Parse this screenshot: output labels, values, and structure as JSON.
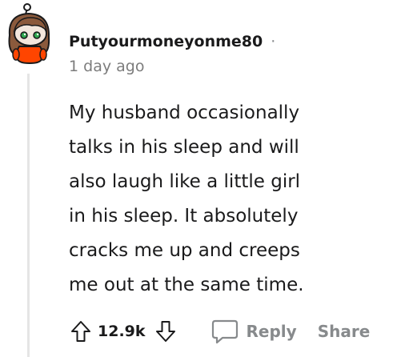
{
  "comment": {
    "username": "Putyourmoneyonme80",
    "separator": "·",
    "timestamp": "1 day ago",
    "body_lines": [
      "My husband occasionally",
      "talks in his sleep and will",
      "also laugh like a little girl",
      "in his sleep. It absolutely",
      "cracks me up and creeps",
      "me out at the same time."
    ],
    "avatar_icon": "snoo-avatar-icon",
    "actions": {
      "upvote_icon": "arrow-up-icon",
      "score": "12.9k",
      "downvote_icon": "arrow-down-icon",
      "reply_icon": "speech-bubble-icon",
      "reply_label": "Reply",
      "share_label": "Share"
    }
  },
  "colors": {
    "text_primary": "#1a1a1b",
    "text_muted": "#878a8c",
    "thread_line": "#e5e5e5",
    "avatar_shirt": "#ff4500",
    "avatar_hair": "#8b5a3c"
  }
}
